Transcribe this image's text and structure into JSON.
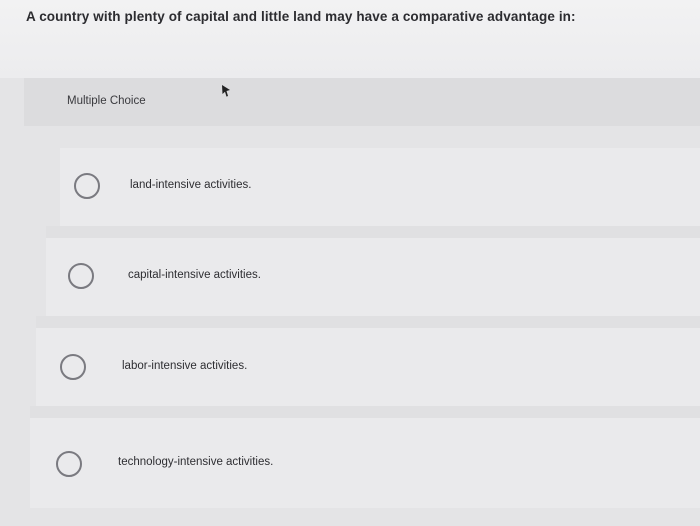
{
  "question": {
    "text": "A country with plenty of capital and little land may have a comparative advantage in:"
  },
  "question_type": {
    "label": "Multiple Choice"
  },
  "options": [
    {
      "label": "land-intensive activities."
    },
    {
      "label": "capital-intensive activities."
    },
    {
      "label": "labor-intensive activities."
    },
    {
      "label": "technology-intensive activities."
    }
  ],
  "icons": {
    "cursor": "mouse-pointer-icon",
    "radio": "radio-button-unchecked"
  },
  "colors": {
    "background": "#e4e4e6",
    "text": "#2b2b2e",
    "radio_border": "#7a7a80"
  }
}
